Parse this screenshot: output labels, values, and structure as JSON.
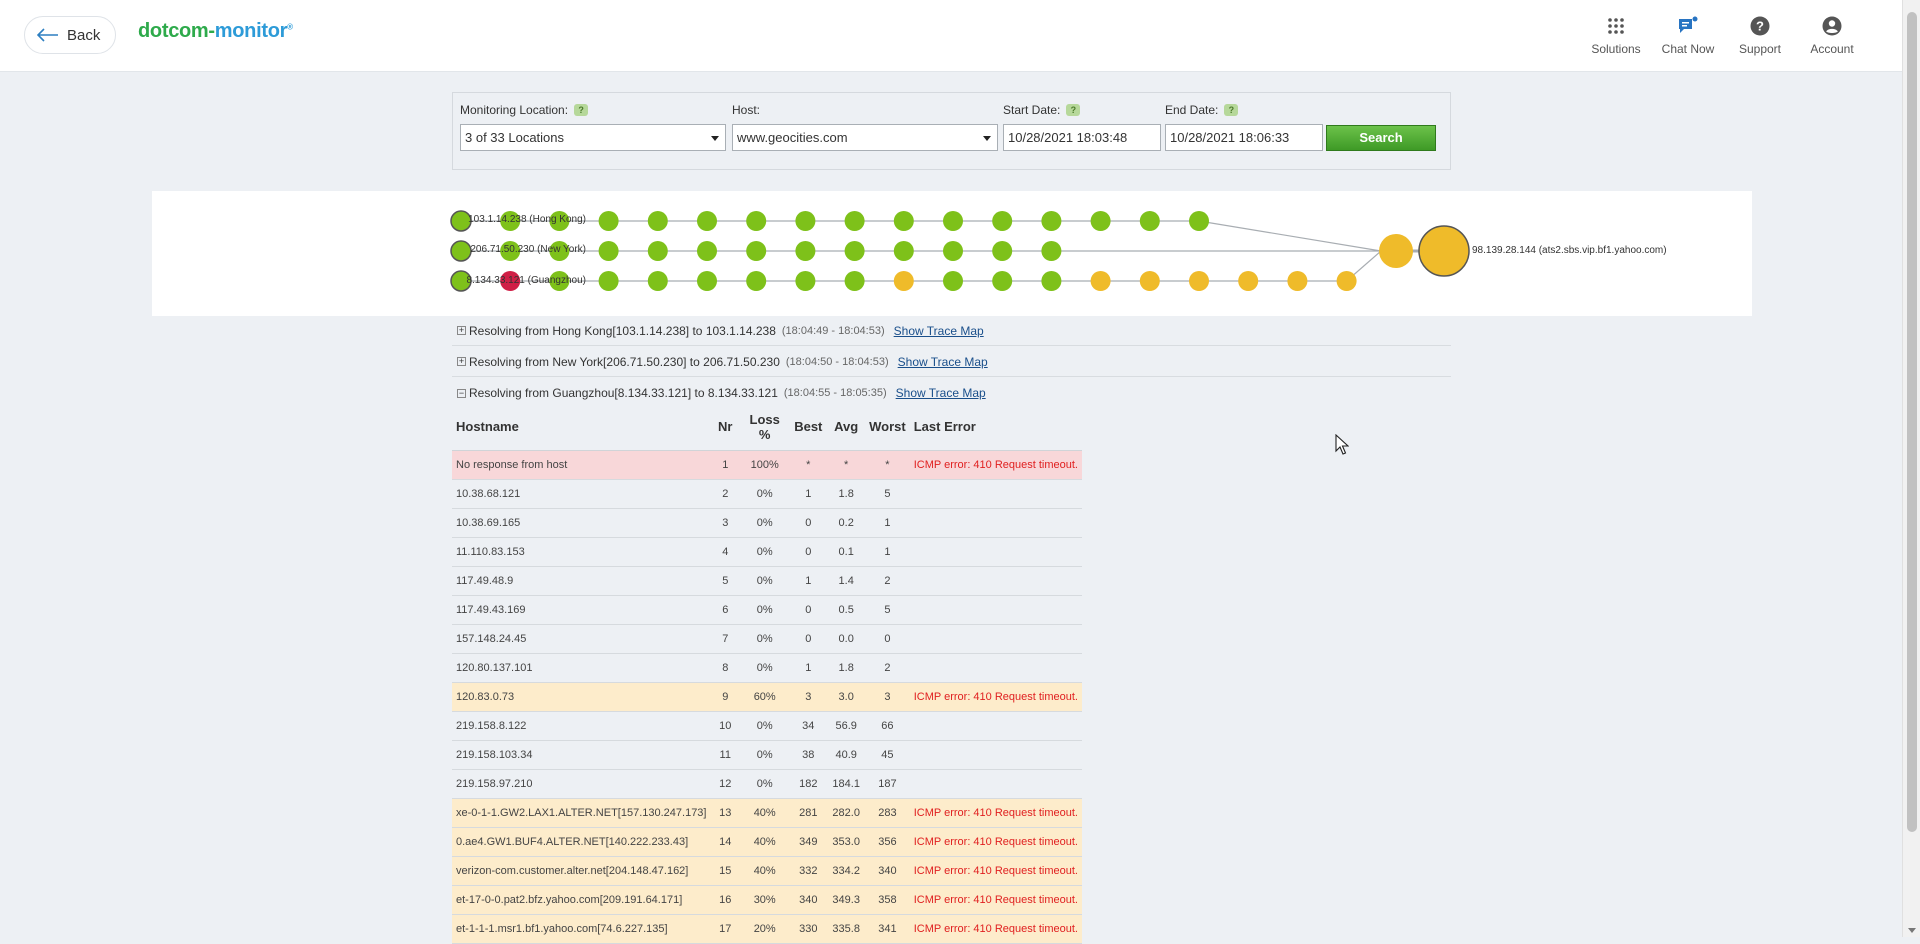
{
  "header": {
    "back_label": "Back",
    "logo_part1": "dotcom-",
    "logo_part2": "monitor",
    "nav": [
      {
        "label": "Solutions",
        "icon": "grid-icon"
      },
      {
        "label": "Chat Now",
        "icon": "chat-icon"
      },
      {
        "label": "Support",
        "icon": "question-icon"
      },
      {
        "label": "Account",
        "icon": "account-icon"
      }
    ]
  },
  "filter": {
    "monitoring_location_label": "Monitoring Location:",
    "monitoring_location_value": "3 of 33 Locations",
    "host_label": "Host:",
    "host_value": "www.geocities.com",
    "start_date_label": "Start Date:",
    "start_date_value": "10/28/2021 18:03:48",
    "end_date_label": "End Date:",
    "end_date_value": "10/28/2021 18:06:33",
    "search_label": "Search",
    "help_glyph": "?"
  },
  "trace_map": {
    "destination_label": "98.139.28.144 (ats2.sbs.vip.bf1.yahoo.com)",
    "routes": [
      {
        "label": "103.1.14.238 (Hong Kong)",
        "hops": [
          "green",
          "green",
          "green",
          "green",
          "green",
          "green",
          "green",
          "green",
          "green",
          "green",
          "green",
          "green",
          "green",
          "green",
          "green"
        ]
      },
      {
        "label": "206.71.50.230 (New York)",
        "hops": [
          "green",
          "green",
          "green",
          "green",
          "green",
          "green",
          "green",
          "green",
          "green",
          "green",
          "green",
          "green"
        ]
      },
      {
        "label": "8.134.33.121 (Guangzhou)",
        "hops": [
          "red",
          "green",
          "green",
          "green",
          "green",
          "green",
          "green",
          "green",
          "yellow",
          "green",
          "green",
          "green",
          "yellow",
          "yellow",
          "yellow",
          "yellow",
          "yellow",
          "yellow"
        ]
      }
    ],
    "colors": {
      "green": "#7ec11a",
      "red": "#d01f46",
      "yellow": "#efbb2a",
      "line": "#a8adb2"
    }
  },
  "resolve_rows": [
    {
      "toggle": "+",
      "text": "Resolving from Hong Kong[103.1.14.238] to 103.1.14.238",
      "time": "(18:04:49 - 18:04:53)",
      "link": "Show Trace Map"
    },
    {
      "toggle": "+",
      "text": "Resolving from New York[206.71.50.230] to 206.71.50.230",
      "time": "(18:04:50 - 18:04:53)",
      "link": "Show Trace Map"
    },
    {
      "toggle": "−",
      "text": "Resolving from Guangzhou[8.134.33.121] to 8.134.33.121",
      "time": "(18:04:55 - 18:05:35)",
      "link": "Show Trace Map"
    }
  ],
  "table": {
    "headers": {
      "hostname": "Hostname",
      "nr": "Nr",
      "loss": "Loss %",
      "best": "Best",
      "avg": "Avg",
      "worst": "Worst",
      "last_error": "Last Error"
    },
    "rows": [
      {
        "status": "err",
        "hostname": "No response from host",
        "nr": "1",
        "loss": "100%",
        "best": "*",
        "avg": "*",
        "worst": "*",
        "last_error": "ICMP error: 410 Request timeout."
      },
      {
        "status": "ok",
        "hostname": "10.38.68.121",
        "nr": "2",
        "loss": "0%",
        "best": "1",
        "avg": "1.8",
        "worst": "5",
        "last_error": ""
      },
      {
        "status": "ok",
        "hostname": "10.38.69.165",
        "nr": "3",
        "loss": "0%",
        "best": "0",
        "avg": "0.2",
        "worst": "1",
        "last_error": ""
      },
      {
        "status": "ok",
        "hostname": "11.110.83.153",
        "nr": "4",
        "loss": "0%",
        "best": "0",
        "avg": "0.1",
        "worst": "1",
        "last_error": ""
      },
      {
        "status": "ok",
        "hostname": "117.49.48.9",
        "nr": "5",
        "loss": "0%",
        "best": "1",
        "avg": "1.4",
        "worst": "2",
        "last_error": ""
      },
      {
        "status": "ok",
        "hostname": "117.49.43.169",
        "nr": "6",
        "loss": "0%",
        "best": "0",
        "avg": "0.5",
        "worst": "5",
        "last_error": ""
      },
      {
        "status": "ok",
        "hostname": "157.148.24.45",
        "nr": "7",
        "loss": "0%",
        "best": "0",
        "avg": "0.0",
        "worst": "0",
        "last_error": ""
      },
      {
        "status": "ok",
        "hostname": "120.80.137.101",
        "nr": "8",
        "loss": "0%",
        "best": "1",
        "avg": "1.8",
        "worst": "2",
        "last_error": ""
      },
      {
        "status": "warn",
        "hostname": "120.83.0.73",
        "nr": "9",
        "loss": "60%",
        "best": "3",
        "avg": "3.0",
        "worst": "3",
        "last_error": "ICMP error: 410 Request timeout."
      },
      {
        "status": "ok",
        "hostname": "219.158.8.122",
        "nr": "10",
        "loss": "0%",
        "best": "34",
        "avg": "56.9",
        "worst": "66",
        "last_error": ""
      },
      {
        "status": "ok",
        "hostname": "219.158.103.34",
        "nr": "11",
        "loss": "0%",
        "best": "38",
        "avg": "40.9",
        "worst": "45",
        "last_error": ""
      },
      {
        "status": "ok",
        "hostname": "219.158.97.210",
        "nr": "12",
        "loss": "0%",
        "best": "182",
        "avg": "184.1",
        "worst": "187",
        "last_error": ""
      },
      {
        "status": "warn",
        "hostname": "xe-0-1-1.GW2.LAX1.ALTER.NET[157.130.247.173]",
        "nr": "13",
        "loss": "40%",
        "best": "281",
        "avg": "282.0",
        "worst": "283",
        "last_error": "ICMP error: 410 Request timeout."
      },
      {
        "status": "warn",
        "hostname": "0.ae4.GW1.BUF4.ALTER.NET[140.222.233.43]",
        "nr": "14",
        "loss": "40%",
        "best": "349",
        "avg": "353.0",
        "worst": "356",
        "last_error": "ICMP error: 410 Request timeout."
      },
      {
        "status": "warn",
        "hostname": "verizon-com.customer.alter.net[204.148.47.162]",
        "nr": "15",
        "loss": "40%",
        "best": "332",
        "avg": "334.2",
        "worst": "340",
        "last_error": "ICMP error: 410 Request timeout."
      },
      {
        "status": "warn",
        "hostname": "et-17-0-0.pat2.bfz.yahoo.com[209.191.64.171]",
        "nr": "16",
        "loss": "30%",
        "best": "340",
        "avg": "349.3",
        "worst": "358",
        "last_error": "ICMP error: 410 Request timeout."
      },
      {
        "status": "warn",
        "hostname": "et-1-1-1.msr1.bf1.yahoo.com[74.6.227.135]",
        "nr": "17",
        "loss": "20%",
        "best": "330",
        "avg": "335.8",
        "worst": "341",
        "last_error": "ICMP error: 410 Request timeout."
      }
    ]
  }
}
